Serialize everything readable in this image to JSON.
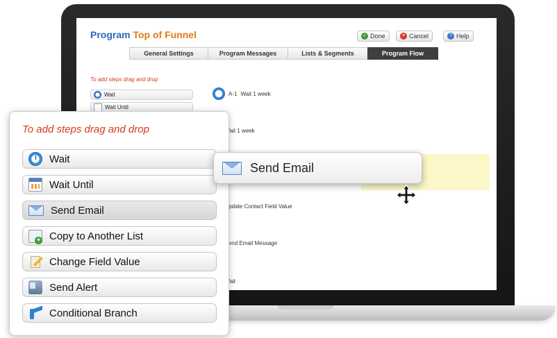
{
  "app": {
    "title_label": "Program",
    "title_name": "Top of Funnel",
    "buttons": {
      "done": "Done",
      "cancel": "Cancel",
      "help": "Help"
    },
    "tabs": [
      {
        "label": "General Settings",
        "active": false
      },
      {
        "label": "Program Messages",
        "active": false
      },
      {
        "label": "Lists & Segments",
        "active": false
      },
      {
        "label": "Program Flow",
        "active": true
      }
    ]
  },
  "palette_small": {
    "hint": "To add steps drag and drop",
    "items": [
      "Wait",
      "Wait Until"
    ]
  },
  "flow_steps": [
    {
      "id": "A-1",
      "text": "Wait 1 week"
    },
    {
      "id": "A-2",
      "text": "Wait 1 week"
    },
    {
      "id": "A-4",
      "text": "Update Contact Field Value"
    },
    {
      "id": "A-5",
      "text": "Send Email Message"
    },
    {
      "id": "A-6",
      "text": "Wait"
    }
  ],
  "palette": {
    "hint": "To add steps drag and drop",
    "items": [
      {
        "label": "Wait",
        "icon": "clock-icon"
      },
      {
        "label": "Wait Until",
        "icon": "calendar-icon"
      },
      {
        "label": "Send Email",
        "icon": "envelope-icon"
      },
      {
        "label": "Copy to Another List",
        "icon": "copy-list-icon"
      },
      {
        "label": "Change Field Value",
        "icon": "pencil-icon"
      },
      {
        "label": "Send Alert",
        "icon": "phone-icon"
      },
      {
        "label": "Conditional Branch",
        "icon": "branch-icon"
      }
    ]
  },
  "dragging": {
    "label": "Send Email",
    "icon": "envelope-icon"
  },
  "colors": {
    "accent_blue": "#2a69b5",
    "accent_orange": "#e07a1a",
    "hint_red": "#d23b1a",
    "drop_highlight": "#fbf7c8"
  }
}
